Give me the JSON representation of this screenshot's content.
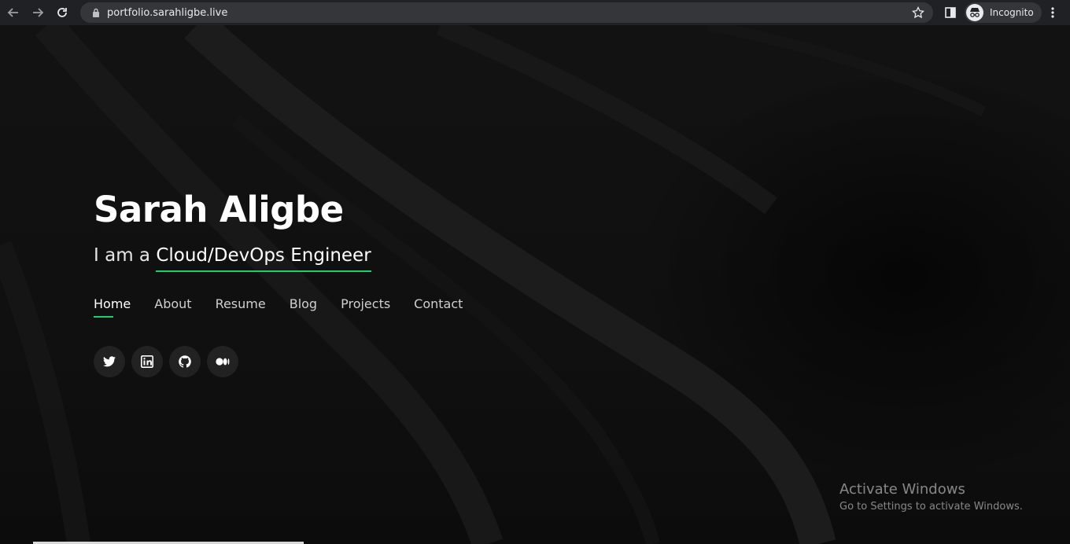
{
  "browser": {
    "url": "portfolio.sarahligbe.live",
    "incognito_label": "Incognito",
    "icons": [
      "back-icon",
      "forward-icon",
      "reload-icon",
      "lock-icon",
      "star-icon",
      "side-panel-icon",
      "incognito-icon",
      "menu-icon"
    ]
  },
  "hero": {
    "name": "Sarah Aligbe",
    "tagline_prefix": "I am a ",
    "role": "Cloud/DevOps Engineer",
    "accent_color": "#18d26e"
  },
  "nav": {
    "items": [
      {
        "label": "Home",
        "active": true
      },
      {
        "label": "About"
      },
      {
        "label": "Resume"
      },
      {
        "label": "Blog"
      },
      {
        "label": "Projects"
      },
      {
        "label": "Contact"
      }
    ]
  },
  "socials": [
    "twitter-icon",
    "linkedin-icon",
    "github-icon",
    "medium-icon"
  ],
  "watermark": {
    "title": "Activate Windows",
    "subtitle": "Go to Settings to activate Windows."
  }
}
